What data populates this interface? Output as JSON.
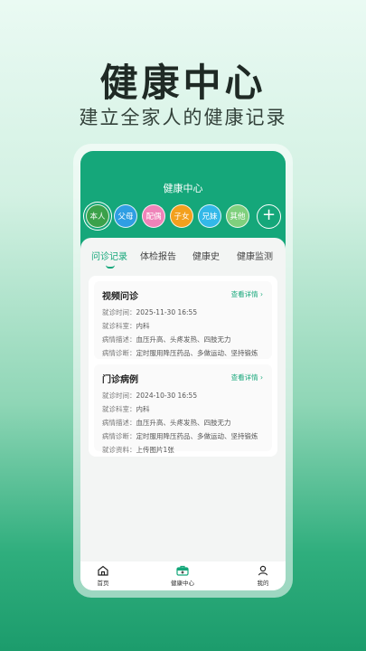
{
  "hero": {
    "title": "健康中心",
    "subtitle": "建立全家人的健康记录"
  },
  "app": {
    "header_title": "健康中心",
    "members": [
      {
        "label": "本人",
        "color": "#3aa14a",
        "selected": true
      },
      {
        "label": "父母",
        "color": "#2f9ee3"
      },
      {
        "label": "配偶",
        "color": "#ef83b9"
      },
      {
        "label": "子女",
        "color": "#f3a01d"
      },
      {
        "label": "兄妹",
        "color": "#32b8e8"
      },
      {
        "label": "其他",
        "color": "#7fd07d"
      }
    ],
    "add_label": "+",
    "tabs": [
      "问诊记录",
      "体检报告",
      "健康史",
      "健康监测"
    ],
    "active_tab": 0,
    "records": [
      {
        "title": "视频问诊",
        "detail_label": "查看详情",
        "lines": [
          {
            "label": "就诊时间：",
            "value": "2025-11-30 16:55"
          },
          {
            "label": "就诊科室：",
            "value": "内科"
          },
          {
            "label": "病情描述：",
            "value": "血压升高、头疼发热、四肢无力"
          },
          {
            "label": "病情诊断：",
            "value": "定时服用降压药品、多做运动、坚持锻炼"
          }
        ]
      },
      {
        "title": "门诊病例",
        "detail_label": "查看详情",
        "lines": [
          {
            "label": "就诊时间：",
            "value": "2024-10-30 16:55"
          },
          {
            "label": "就诊科室：",
            "value": "内科"
          },
          {
            "label": "病情描述：",
            "value": "血压升高、头疼发热、四肢无力"
          },
          {
            "label": "病情诊断：",
            "value": "定时服用降压药品、多做运动、坚持锻炼"
          },
          {
            "label": "就诊资料：",
            "value": "上传图片1张"
          }
        ]
      }
    ],
    "nav": [
      {
        "label": "首页",
        "icon": "home-icon"
      },
      {
        "label": "健康中心",
        "icon": "medical-kit-icon",
        "active": true
      },
      {
        "label": "我的",
        "icon": "user-icon"
      }
    ],
    "colors": {
      "accent": "#15a77a"
    }
  }
}
